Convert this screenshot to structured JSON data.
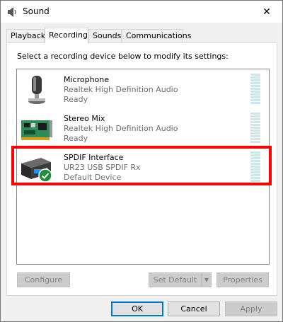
{
  "window": {
    "title": "Sound",
    "close_label": "✕"
  },
  "tabs": [
    {
      "label": "Playback",
      "active": false
    },
    {
      "label": "Recording",
      "active": true
    },
    {
      "label": "Sounds",
      "active": false
    },
    {
      "label": "Communications",
      "active": false
    }
  ],
  "instruction": "Select a recording device below to modify its settings:",
  "devices": [
    {
      "name": "Microphone",
      "description": "Realtek High Definition Audio",
      "status": "Ready",
      "icon": "microphone-icon"
    },
    {
      "name": "Stereo Mix",
      "description": "Realtek High Definition Audio",
      "status": "Ready",
      "icon": "sound-card-icon"
    },
    {
      "name": "SPDIF Interface",
      "description": "UR23 USB SPDIF Rx",
      "status": "Default Device",
      "icon": "usb-audio-interface-icon",
      "default_badge": "green-check-icon"
    }
  ],
  "panel_buttons": {
    "configure": "Configure",
    "set_default": "Set Default",
    "properties": "Properties"
  },
  "dialog_buttons": {
    "ok": "OK",
    "cancel": "Cancel",
    "apply": "Apply"
  },
  "colors": {
    "highlight": "#ff0000",
    "secondary_text": "#6d6d6d",
    "meter": "#cfe6e6",
    "default_button_border": "#0078d7",
    "check_badge": "#1e8e3e"
  }
}
